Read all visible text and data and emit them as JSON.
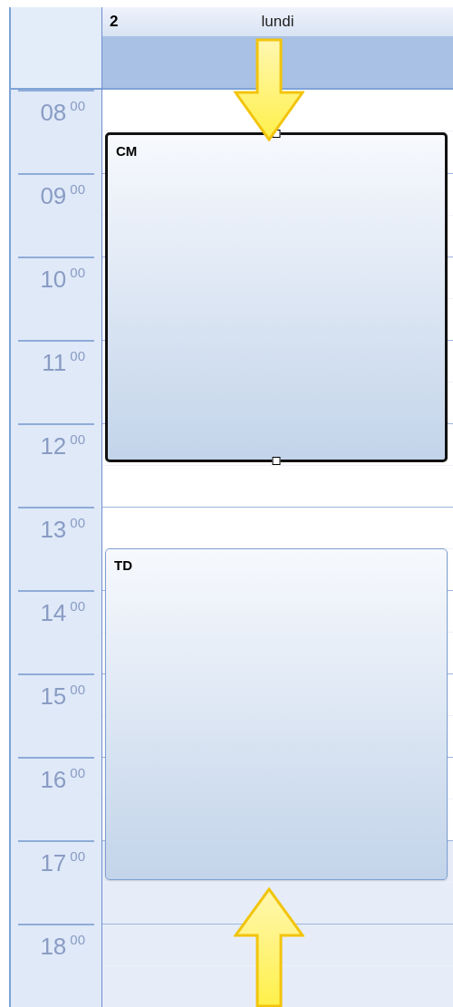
{
  "day": {
    "number": "2",
    "name": "lundi"
  },
  "hours": [
    {
      "hour": "08",
      "minutes": "00",
      "working": true
    },
    {
      "hour": "09",
      "minutes": "00",
      "working": true
    },
    {
      "hour": "10",
      "minutes": "00",
      "working": true
    },
    {
      "hour": "11",
      "minutes": "00",
      "working": true
    },
    {
      "hour": "12",
      "minutes": "00",
      "working": true
    },
    {
      "hour": "13",
      "minutes": "00",
      "working": true
    },
    {
      "hour": "14",
      "minutes": "00",
      "working": true
    },
    {
      "hour": "15",
      "minutes": "00",
      "working": true
    },
    {
      "hour": "16",
      "minutes": "00",
      "working": true
    },
    {
      "hour": "17",
      "minutes": "00",
      "working": false
    },
    {
      "hour": "18",
      "minutes": "00",
      "working": false
    }
  ],
  "events": [
    {
      "title": "CM",
      "selected": true
    },
    {
      "title": "TD",
      "selected": false
    }
  ]
}
